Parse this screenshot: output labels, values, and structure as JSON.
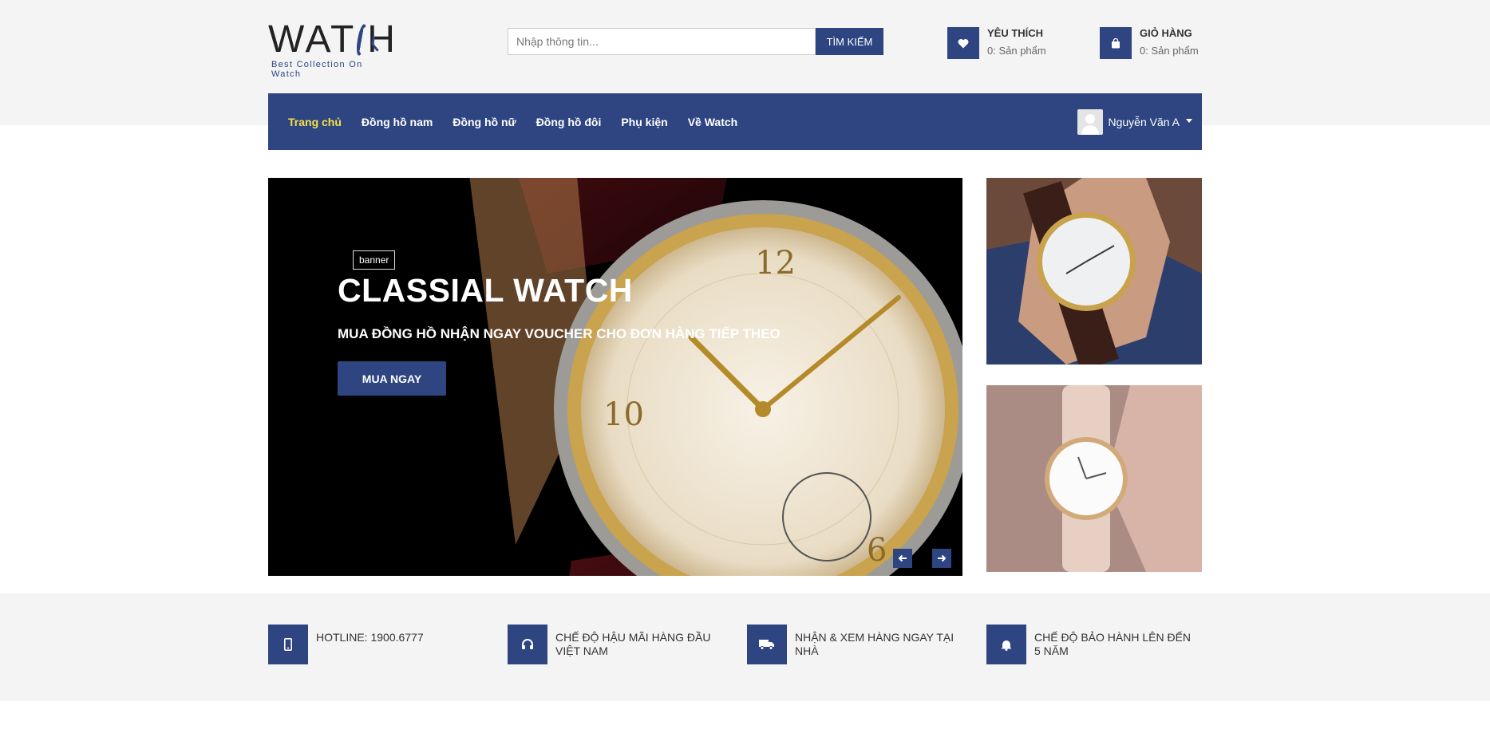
{
  "header": {
    "logo_text": "WATCH",
    "logo_tagline": "Best Collection On Watch",
    "search": {
      "placeholder": "Nhập thông tin...",
      "button": "TÌM KIẾM"
    },
    "wishlist": {
      "title": "YÊU THÍCH",
      "count": "0: Sản phẩm",
      "icon": "heart-icon"
    },
    "cart": {
      "title": "GIỎ HÀNG",
      "count": "0: Sản phẩm",
      "icon": "shopping-bag-icon"
    }
  },
  "nav": {
    "items": [
      {
        "label": "Trang chủ",
        "active": true
      },
      {
        "label": "Đồng hồ nam"
      },
      {
        "label": "Đồng hồ nữ"
      },
      {
        "label": "Đồng hồ đôi"
      },
      {
        "label": "Phụ kiện"
      },
      {
        "label": "Về Watch"
      }
    ],
    "user_name": "Nguyễn Văn A"
  },
  "banner": {
    "tag": "banner",
    "title": "CLASSIAL WATCH",
    "subtitle": "MUA ĐỒNG HỒ NHẬN NGAY VOUCHER CHO ĐƠN HÀNG TIẾP THEO",
    "button": "MUA NGAY"
  },
  "features": [
    {
      "icon": "mobile-phone-icon",
      "text": "HOTLINE: 1900.6777"
    },
    {
      "icon": "headphones-icon",
      "text": "CHẾ ĐỘ HẬU MÃI HÀNG ĐẦU VIỆT NAM"
    },
    {
      "icon": "truck-icon",
      "text": "NHẬN & XEM HÀNG NGAY TẠI NHÀ"
    },
    {
      "icon": "bell-icon",
      "text": "CHẾ ĐỘ BẢO HÀNH LÊN ĐẾN 5 NĂM"
    }
  ],
  "colors": {
    "brand": "#2e4582",
    "active_nav": "#f6e04a",
    "band": "#f4f4f4"
  }
}
